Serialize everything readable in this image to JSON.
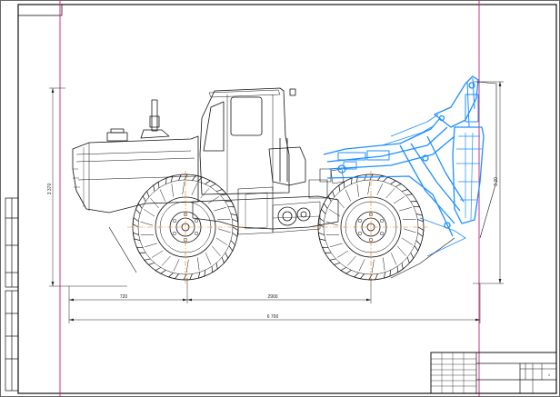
{
  "colors": {
    "line": "#111111",
    "attachment": "#1e8fff",
    "centerline": "#ff7a00",
    "margin_line": "#c8207a"
  },
  "dimensions": {
    "d_front_axle": "720",
    "d_wheelbase": "2900",
    "d_overall": "6 700",
    "d_height": "3 370",
    "d_attachment": "3 20"
  },
  "title_block": {
    "sheet_no": "1"
  }
}
